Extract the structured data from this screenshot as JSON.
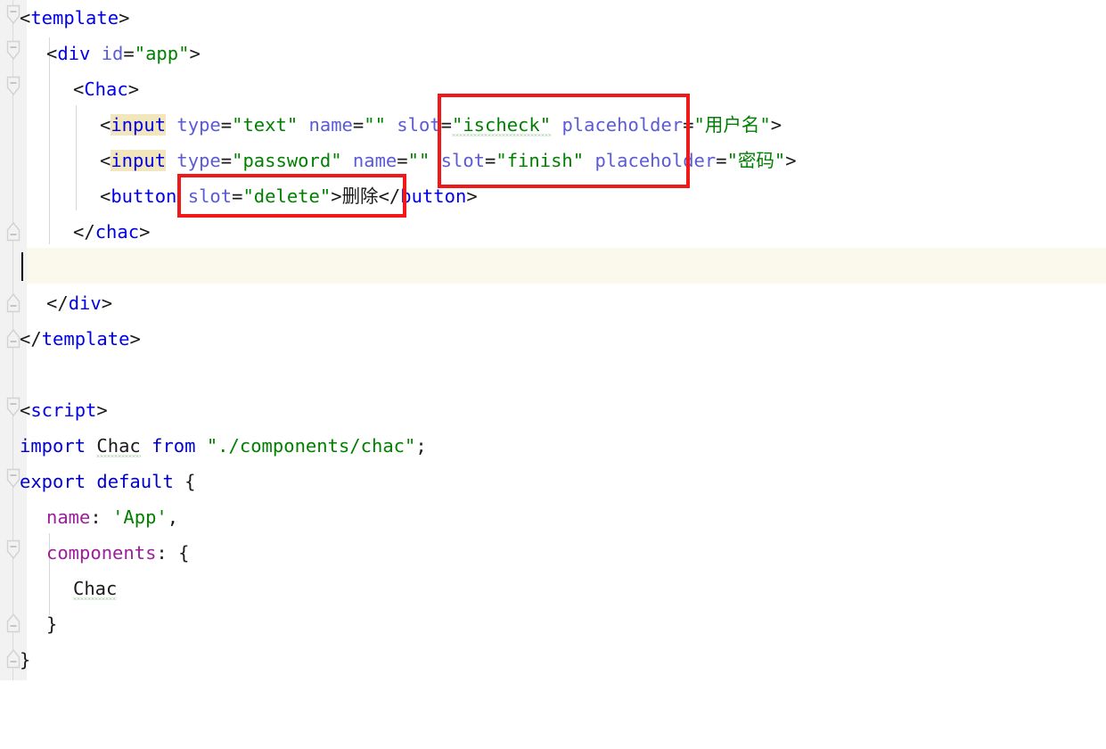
{
  "editor": {
    "language": "vue",
    "font_size_px": 20.5,
    "line_height_px": 40,
    "colors": {
      "background": "#ffffff",
      "gutter": "#f2f2f2",
      "current_line": "#fbf8ec",
      "tag": "#0000e8",
      "attribute": "#5b5bd6",
      "string": "#007f00",
      "property": "#9b1f9b",
      "punctuation": "#1a1a1a",
      "occurrence_highlight": "#f2e6bd",
      "annotation": "#f01818",
      "typo_squiggle": "#79b979",
      "indent_guide": "#d8d8d8"
    }
  },
  "code": {
    "l1": {
      "t1": "<",
      "tag": "template",
      "t2": ">"
    },
    "l2": {
      "t1": "<",
      "tag": "div",
      "sp": " ",
      "attr": "id",
      "eq": "=",
      "val": "\"app\"",
      "t2": ">"
    },
    "l3": {
      "t1": "<",
      "tag": "Chac",
      "t2": ">"
    },
    "l4": {
      "lt": "<",
      "tag": "input",
      "a1": "type",
      "v1": "\"text\"",
      "a2": "name",
      "v2": "\"\"",
      "a3": "slot",
      "v3": "\"ischeck\"",
      "a4": "placeholder",
      "v4": "\"用户名\"",
      "gt": ">"
    },
    "l5": {
      "lt": "<",
      "tag": "input",
      "a1": "type",
      "v1": "\"password\"",
      "a2": "name",
      "v2": "\"\"",
      "a3": "slot",
      "v3": "\"finish\"",
      "a4": "placeholder",
      "v4": "\"密码\"",
      "gt": ">"
    },
    "l6": {
      "lt": "<",
      "tag": "button",
      "a1": "slot",
      "v1": "\"delete\"",
      "gt": ">",
      "text": "删除",
      "close_lt": "</",
      "close_tag": "button",
      "close_gt": ">"
    },
    "l7": {
      "t1": "</",
      "tag": "chac",
      "t2": ">"
    },
    "l8": {
      "text": ""
    },
    "l9": {
      "t1": "</",
      "tag": "div",
      "t2": ">"
    },
    "l10": {
      "t1": "</",
      "tag": "template",
      "t2": ">"
    },
    "l11": {
      "text": ""
    },
    "l12": {
      "t1": "<",
      "tag": "script",
      "t2": ">"
    },
    "l13": {
      "kw1": "import",
      "ident": "Chac",
      "kw2": "from",
      "str": "\"./components/chac\"",
      "semi": ";"
    },
    "l14": {
      "kw1": "export",
      "kw2": "default",
      "brace": "{"
    },
    "l15": {
      "prop": "name",
      "colon": ":",
      "val": "'App'",
      "comma": ","
    },
    "l16": {
      "prop": "components",
      "colon": ":",
      "brace": "{"
    },
    "l17": {
      "ident": "Chac"
    },
    "l18": {
      "brace": "}"
    },
    "l19": {
      "brace": "}"
    }
  },
  "annotations": {
    "box1_label": "slot-attributes-highlight",
    "box2_label": "delete-button-slot-highlight"
  },
  "caret": {
    "line": 8,
    "column": 1
  }
}
